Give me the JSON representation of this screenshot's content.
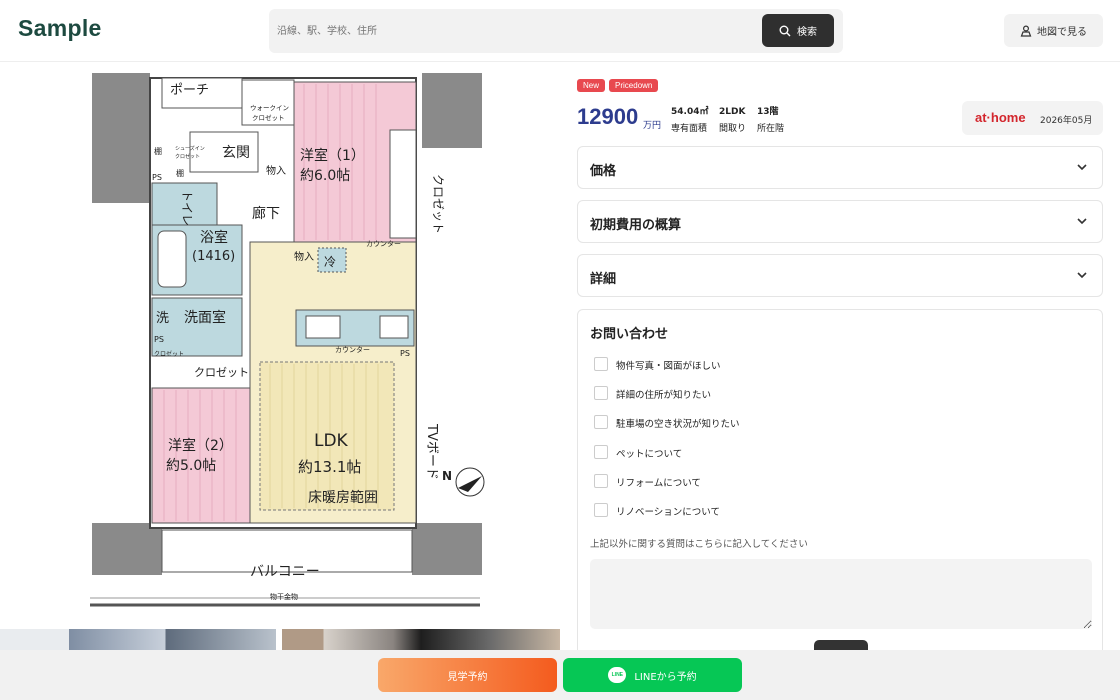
{
  "header": {
    "logo": "Sample",
    "search_placeholder": "沿線、駅、学校、住所",
    "search_button": "検索",
    "map_button": "地図で見る"
  },
  "floorplan": {
    "rooms": {
      "porch": "ポーチ",
      "walkin": "ウォークイン",
      "walkin2": "クロゼット",
      "entrance": "玄関",
      "shoes": "シューズイン",
      "shoes2": "クロゼット",
      "shelf1": "棚",
      "shelf2": "棚",
      "ps1": "PS",
      "ps2": "PS",
      "ps3": "PS",
      "toilet": "トイレ",
      "storage1": "物入",
      "storage2": "物入",
      "corridor": "廊下",
      "bedroom1": "洋室（1）",
      "bedroom1_size": "約6.0帖",
      "closet1": "クロゼット",
      "counter1": "カウンター",
      "bath": "浴室",
      "bath_size": "(1416)",
      "fridge": "冷",
      "wash": "洗",
      "washroom": "洗面室",
      "counter2": "カウンター",
      "closet_small": "クロゼット",
      "closet2": "クロゼット",
      "bedroom2": "洋室（2）",
      "bedroom2_size": "約5.0帖",
      "tvboard": "TVボード",
      "ldk": "LDK",
      "ldk_size": "約13.1帖",
      "floor_heating": "床暖房範囲",
      "balcony": "バルコニー",
      "laundry": "物干金物",
      "north": "N"
    }
  },
  "badges": [
    "New",
    "Pricedown"
  ],
  "price": {
    "value": "12900",
    "unit": "万円"
  },
  "specs": [
    {
      "value": "54.04㎡",
      "label": "専有面積"
    },
    {
      "value": "2LDK",
      "label": "間取り"
    },
    {
      "value": "13階",
      "label": "所在階"
    }
  ],
  "source": {
    "brand": "at·home",
    "date": "2026年05月"
  },
  "accordions": [
    "価格",
    "初期費用の概算",
    "詳細"
  ],
  "contact": {
    "title": "お問い合わせ",
    "options": [
      "物件写真・図面がほしい",
      "詳細の住所が知りたい",
      "駐車場の空き状況が知りたい",
      "ペットについて",
      "リフォームについて",
      "リノベーションについて"
    ],
    "note": "上記以外に関する質問はこちらに記入してください"
  },
  "footer": {
    "visit": "見学予約",
    "line": "LINEから予約",
    "line_icon_text": "LINE"
  },
  "colors": {
    "brand": "#1d4a40",
    "price": "#2d3c8e",
    "badge": "#e8494f",
    "line": "#06c755",
    "visit_start": "#f9a86a",
    "visit_end": "#f45b1e"
  }
}
